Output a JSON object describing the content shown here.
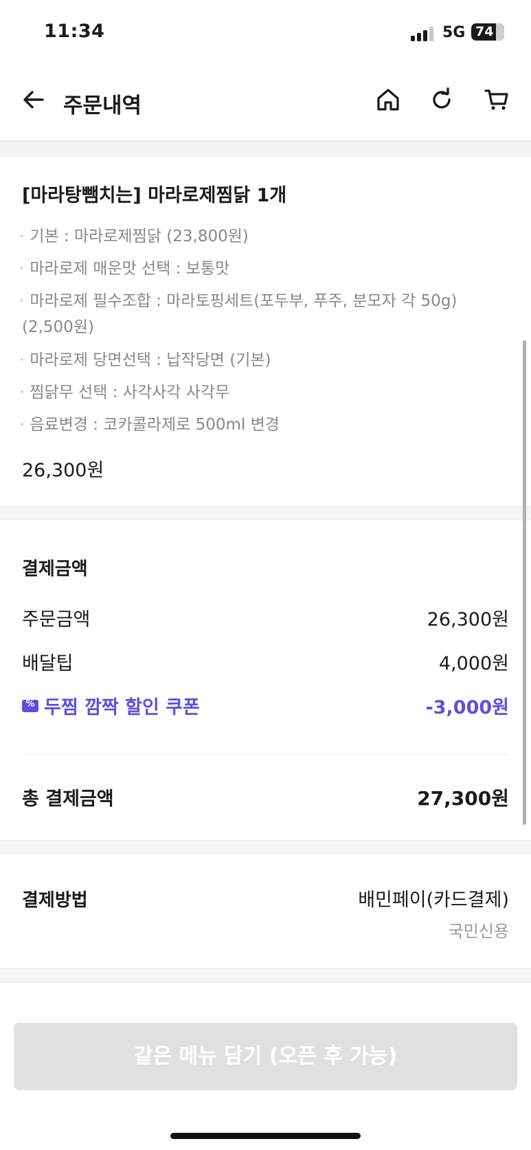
{
  "status_bar": {
    "time": "11:34",
    "network": "5G",
    "battery": "74"
  },
  "header": {
    "title": "주문내역",
    "icons": [
      "back-arrow-icon",
      "home-icon",
      "refresh-icon",
      "cart-icon"
    ]
  },
  "order": {
    "item_title": "[마라탕뺌치는] 마라로제찜닭 1개",
    "options": [
      "기본 : 마라로제찜닭 (23,800원)",
      "마라로제 매운맛 선택 : 보통맛",
      "마라로제 필수조합 : 마라토핑세트(포두부, 푸주, 분모자 각 50g)",
      "(2,500원)",
      "마라로제 당면선택 : 납작당면 (기본)",
      "찜닭무 선택 : 사각사각 사각무",
      "음료변경 : 코카콜라제로 500ml 변경"
    ],
    "price": "26,300원"
  },
  "payment": {
    "title": "결제금액",
    "rows": [
      {
        "label": "주문금액",
        "value": "26,300원"
      },
      {
        "label": "배달팁",
        "value": "4,000원"
      },
      {
        "label": "두찜 깜짝 할인 쿠폰",
        "value": "-3,000원"
      }
    ],
    "total_label": "총 결제금액",
    "total_value": "27,300원",
    "accent_color": "#5b4fe0"
  },
  "method": {
    "label": "결제방법",
    "value": "배민페이(카드결제)",
    "sub": "국민신용"
  },
  "reorder_button": "같은 메뉴 담기 (오픈 후 가능)"
}
